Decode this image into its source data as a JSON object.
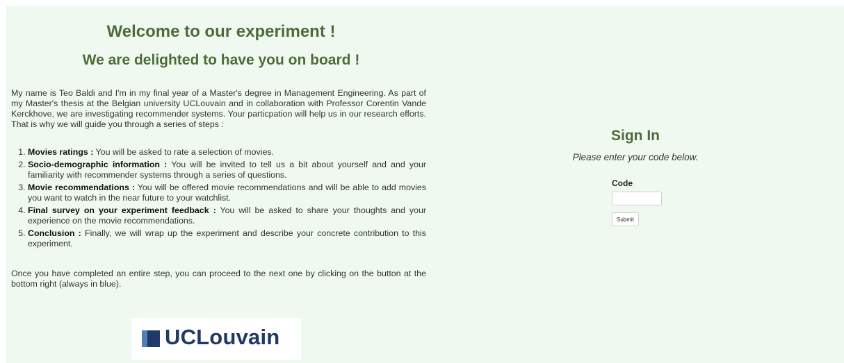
{
  "welcome": {
    "title": "Welcome to our experiment !",
    "subtitle": "We are delighted to have you on board !",
    "intro": "My name is Teo Baldi and I'm in my final year of a Master's degree in Management Engineering. As part of my Master's thesis at the Belgian university UCLouvain and in collaboration with Professor Corentin Vande Kerckhove, we are investigating recommender systems. Your particpation will help us in our research efforts. That is why we will guide you through a series of steps :",
    "steps": [
      {
        "title": "Movies ratings :",
        "text": "You will be asked to rate a selection of movies."
      },
      {
        "title": "Socio-demographic information :",
        "text": "You will be invited to tell us a bit about yourself and and your familiarity with recommender systems through a series of questions."
      },
      {
        "title": "Movie recommendations :",
        "text": "You will be offered movie recommendations and will be able to add movies you want to watch in the near future to your watchlist."
      },
      {
        "title": "Final survey on your experiment feedback :",
        "text": "You will be asked to share your thoughts and your experience on the movie recommendations."
      },
      {
        "title": "Conclusion :",
        "text": "Finally, we will wrap up the experiment and describe your concrete contribution to this experiment."
      }
    ],
    "outro": "Once you have completed an entire step, you can proceed to the next one by clicking on the button at the bottom right (always in blue)."
  },
  "logo": {
    "text": "UCLouvain",
    "icon": "uclouvain-logo-mark",
    "color": "#1f3a66"
  },
  "signin": {
    "title": "Sign In",
    "description": "Please enter your code below.",
    "code_label": "Code",
    "code_value": "",
    "submit_label": "Submit"
  },
  "colors": {
    "background": "#eff9ef",
    "heading": "#4f6b3a"
  }
}
